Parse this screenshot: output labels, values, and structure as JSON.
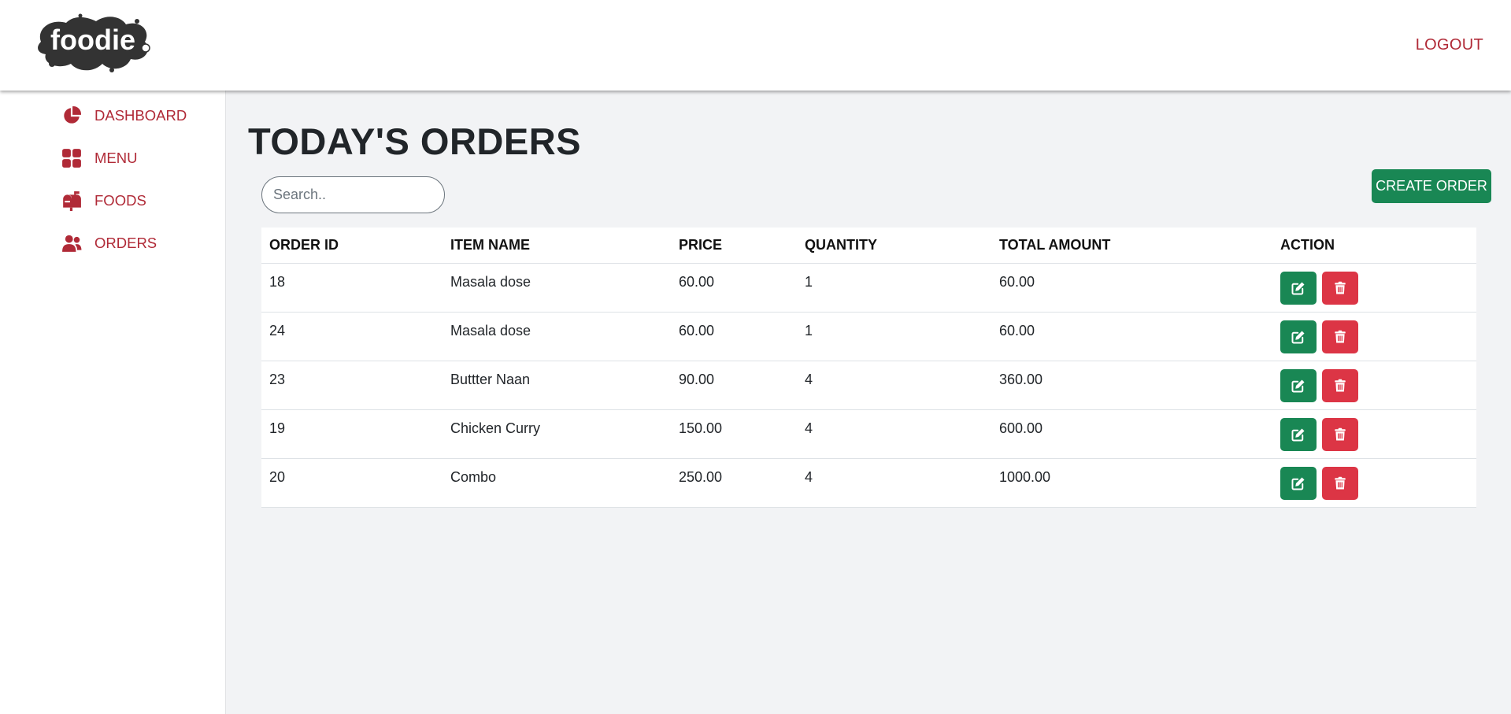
{
  "header": {
    "logo_text": "foodie",
    "logout_label": "LOGOUT"
  },
  "sidebar": {
    "items": [
      {
        "label": "DASHBOARD",
        "icon": "pie-chart-icon"
      },
      {
        "label": "MENU",
        "icon": "grid-icon"
      },
      {
        "label": "FOODS",
        "icon": "mailbox-icon"
      },
      {
        "label": "ORDERS",
        "icon": "users-icon"
      }
    ]
  },
  "main": {
    "title": "TODAY'S ORDERS",
    "search_placeholder": "Search..",
    "create_label": "CREATE ORDER"
  },
  "table": {
    "headers": [
      "ORDER ID",
      "ITEM NAME",
      "PRICE",
      "QUANTITY",
      "TOTAL AMOUNT",
      "ACTION"
    ],
    "rows": [
      [
        "18",
        "Masala dose",
        "60.00",
        "1",
        "60.00"
      ],
      [
        "24",
        "Masala dose",
        "60.00",
        "1",
        "60.00"
      ],
      [
        "23",
        "Buttter Naan",
        "90.00",
        "4",
        "360.00"
      ],
      [
        "19",
        "Chicken Curry",
        "150.00",
        "4",
        "600.00"
      ],
      [
        "20",
        "Combo",
        "250.00",
        "4",
        "1000.00"
      ]
    ]
  },
  "colors": {
    "accent": "#b02a37",
    "edit": "#198754",
    "delete": "#dc3545",
    "background": "#f2f3f5"
  }
}
